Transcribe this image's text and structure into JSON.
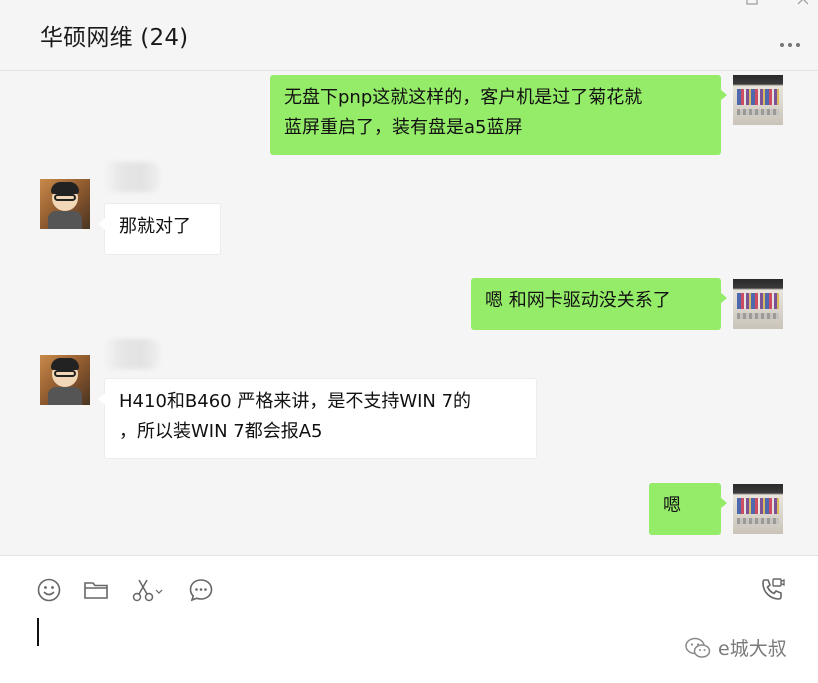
{
  "header": {
    "title": "华硕网维 (24)"
  },
  "messages": [
    {
      "side": "me",
      "text_line1": "无盘下pnp这就这样的，客户机是过了菊花就",
      "text_line2": "蓝屏重启了，装有盘是a5蓝屏"
    },
    {
      "side": "other",
      "text": "那就对了"
    },
    {
      "side": "me",
      "text": "嗯 和网卡驱动没关系了"
    },
    {
      "side": "other",
      "text_line1": "H410和B460 严格来讲，是不支持WIN 7的",
      "text_line2": "，所以装WIN 7都会报A5"
    },
    {
      "side": "me",
      "text": "嗯"
    }
  ],
  "toolbar": {
    "emoji": "emoji-icon",
    "folder": "folder-icon",
    "scissors": "screenshot-icon",
    "chat": "chat-history-icon",
    "call": "voice-video-call-icon"
  },
  "watermark": {
    "text": "e城大叔"
  },
  "colors": {
    "my_bubble": "#95ec69",
    "other_bubble": "#ffffff",
    "background": "#f5f5f5"
  }
}
